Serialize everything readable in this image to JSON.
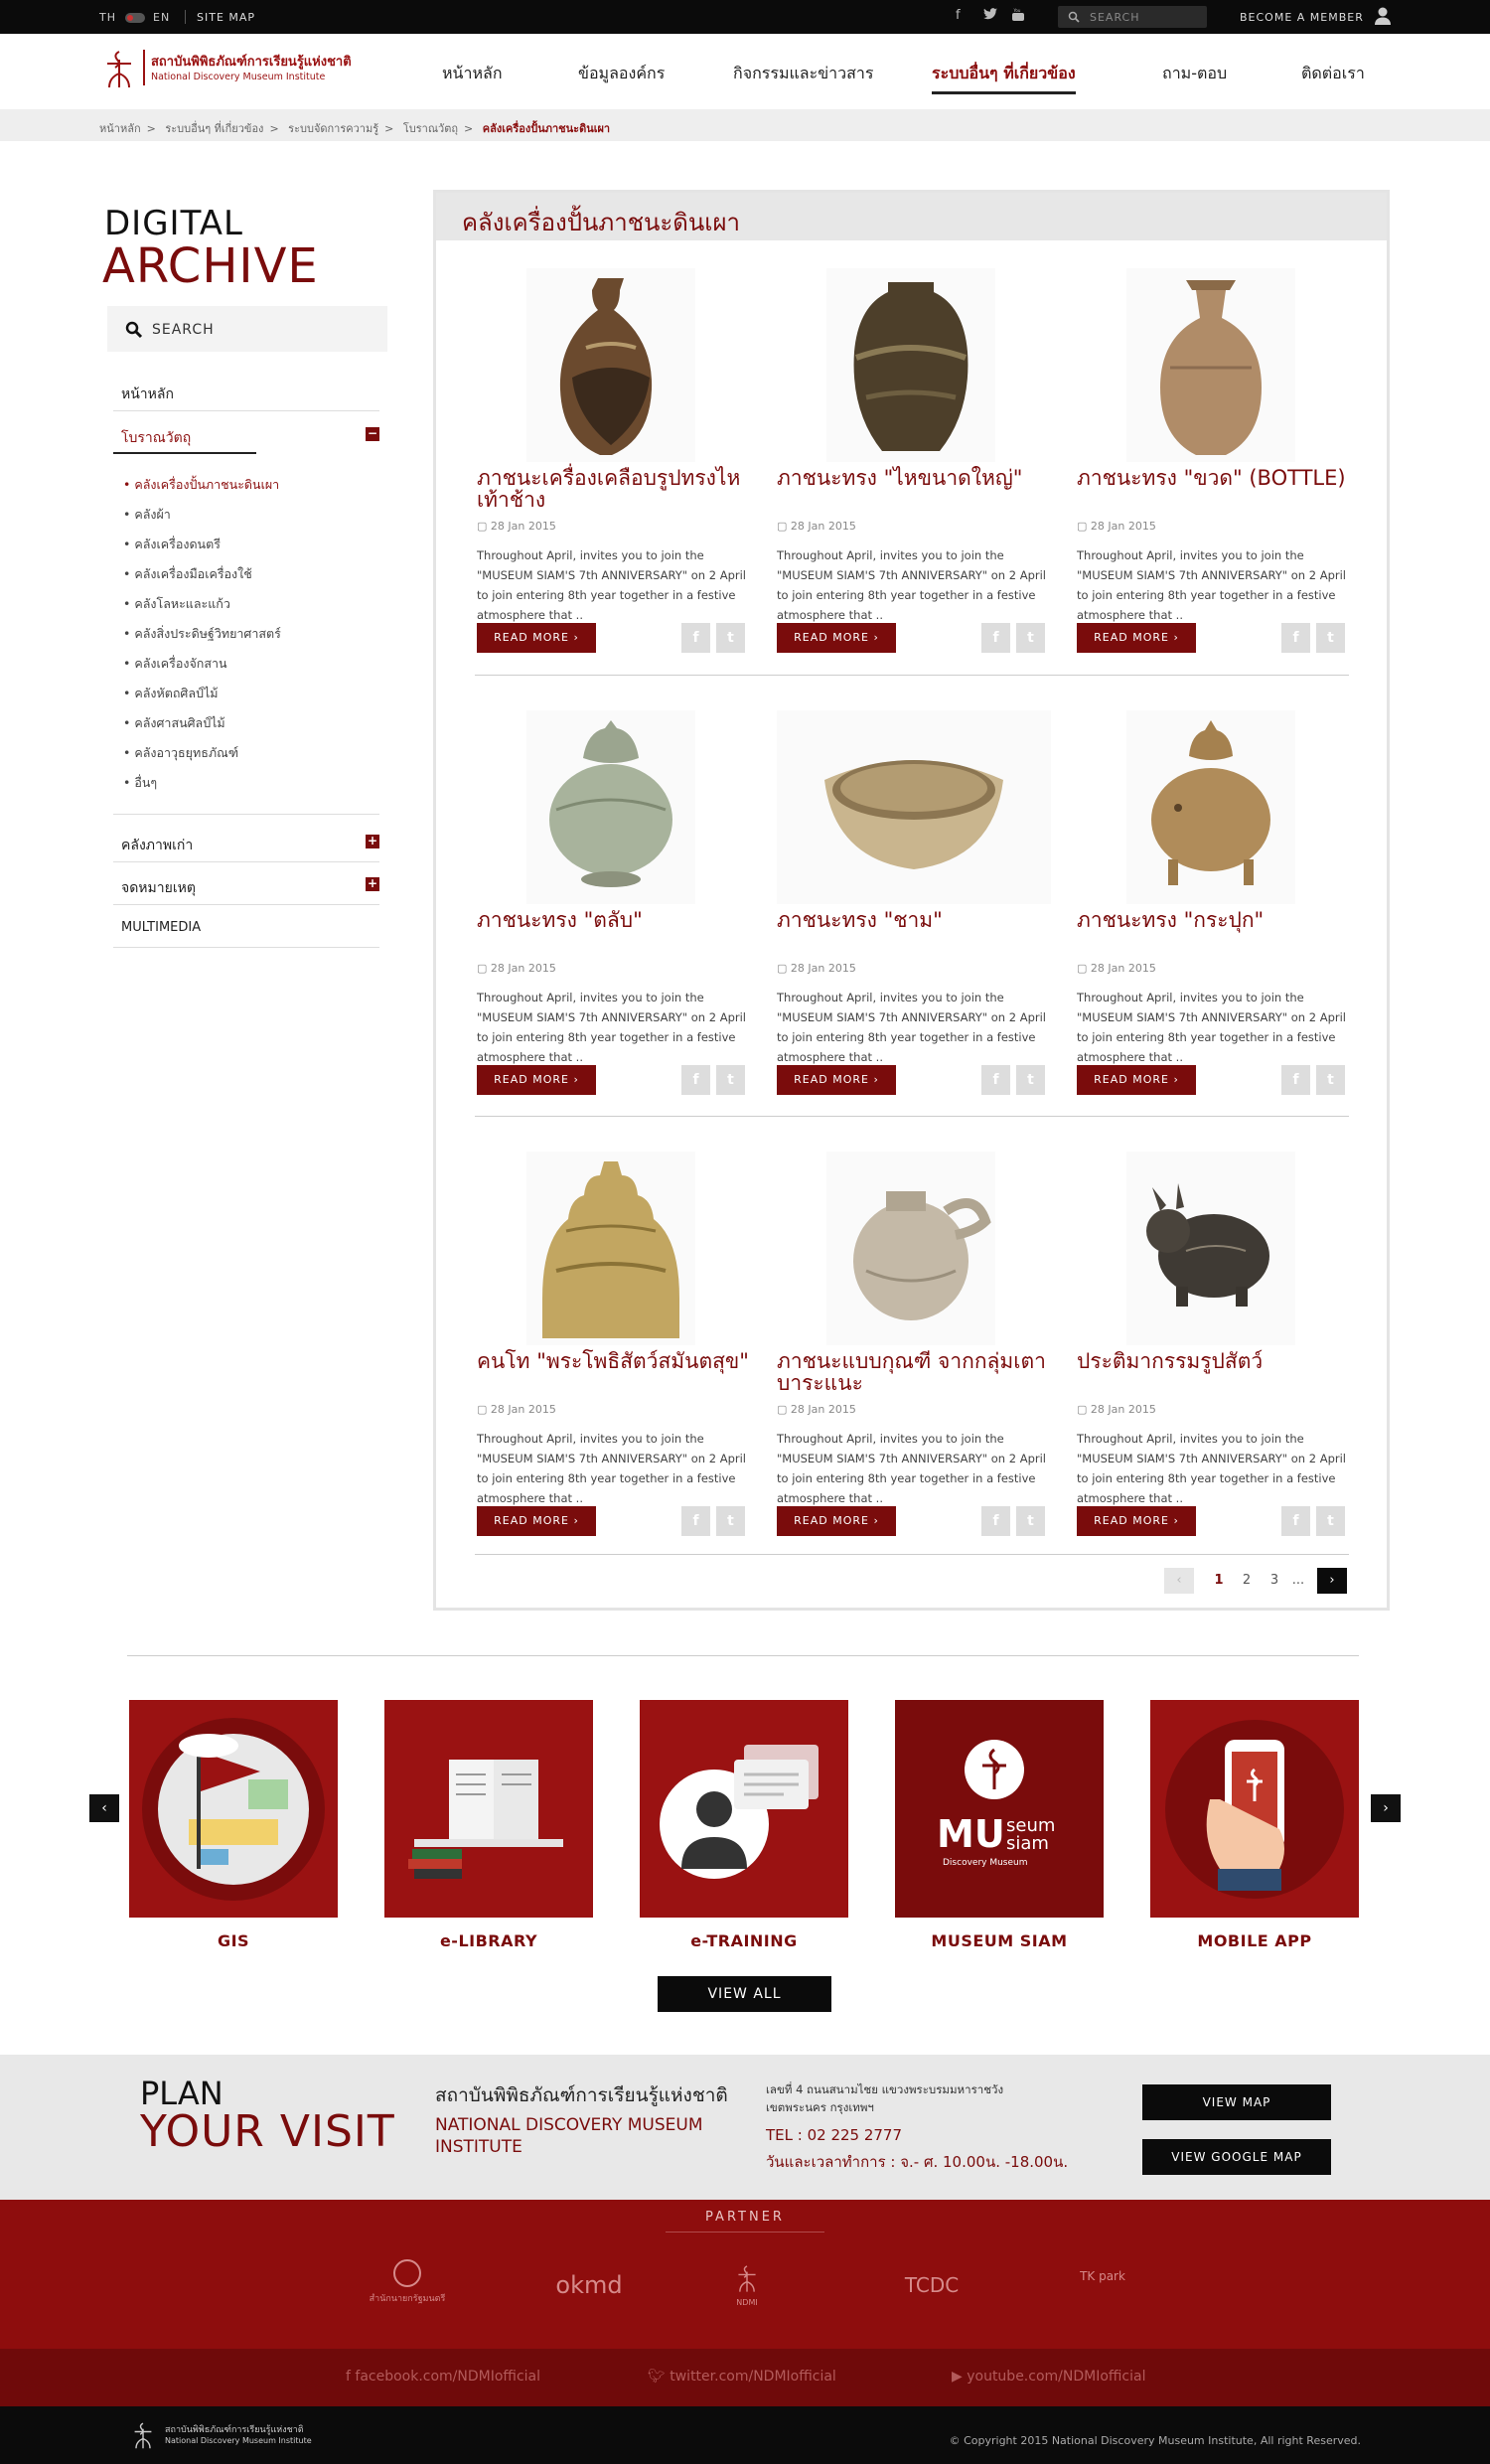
{
  "topbar": {
    "lang_th": "TH",
    "lang_en": "EN",
    "site_map": "SITE MAP",
    "search_placeholder": "SEARCH",
    "become_member": "BECOME A MEMBER"
  },
  "logo": {
    "th": "สถาบันพิพิธภัณฑ์การเรียนรู้แห่งชาติ",
    "en": "National Discovery Museum Institute"
  },
  "nav": {
    "items": [
      "หน้าหลัก",
      "ข้อมูลองค์กร",
      "กิจกรรมและข่าวสาร",
      "ระบบอื่นๆ ที่เกี่ยวข้อง",
      "ถาม-ตอบ",
      "ติดต่อเรา"
    ],
    "active_index": 3
  },
  "breadcrumb": [
    "หน้าหลัก",
    "ระบบอื่นๆ ที่เกี่ยวข้อง",
    "ระบบจัดการความรู้",
    "โบราณวัตถุ",
    "คลังเครื่องปั้นภาชนะดินเผา"
  ],
  "sidebar": {
    "title1": "DIGITAL",
    "title2": "ARCHIVE",
    "search_label": "SEARCH",
    "home": "หน้าหลัก",
    "antiques": "โบราณวัตถุ",
    "sub_items": [
      "คลังเครื่องปั้นภาชนะดินเผา",
      "คลังผ้า",
      "คลังเครื่องดนตรี",
      "คลังเครื่องมือเครื่องใช้",
      "คลังโลหะและแก้ว",
      "คลังสิ่งประดิษฐ์วิทยาศาสตร์",
      "คลังเครื่องจักสาน",
      "คลังหัตถศิลป์ไม้",
      "คลังศาสนศิลป์ไม้",
      "คลังอาวุธยุทธภัณฑ์",
      "อื่นๆ"
    ],
    "old_photos": "คลังภาพเก่า",
    "archives": "จดหมายเหตุ",
    "multimedia": "MULTIMEDIA"
  },
  "main": {
    "heading": "คลังเครื่องปั้นภาชนะดินเผา",
    "read_more": "READ MORE",
    "items": [
      {
        "title": "ภาชนะเครื่องเคลือบรูปทรงไหเท้าช้าง",
        "date": "28 Jan 2015",
        "desc": "Throughout April, invites you to join the \"MUSEUM SIAM'S 7th ANNIVERSARY\" on 2 April to join entering 8th year together in a festive atmosphere that .."
      },
      {
        "title": "ภาชนะทรง \"ไหขนาดใหญ่\"",
        "date": "28 Jan 2015",
        "desc": "Throughout April, invites you to join the \"MUSEUM SIAM'S 7th ANNIVERSARY\" on 2 April to join entering 8th year together in a festive atmosphere that .."
      },
      {
        "title": "ภาชนะทรง \"ขวด\" (BOTTLE)",
        "date": "28 Jan 2015",
        "desc": "Throughout April, invites you to join the \"MUSEUM SIAM'S 7th ANNIVERSARY\" on 2 April to join entering 8th year together in a festive atmosphere that .."
      },
      {
        "title": "ภาชนะทรง \"ตลับ\"",
        "date": "28 Jan 2015",
        "desc": "Throughout April, invites you to join the \"MUSEUM SIAM'S 7th ANNIVERSARY\" on 2 April to join entering 8th year together in a festive atmosphere that .."
      },
      {
        "title": "ภาชนะทรง \"ชาม\"",
        "date": "28 Jan 2015",
        "desc": "Throughout April, invites you to join the \"MUSEUM SIAM'S 7th ANNIVERSARY\" on 2 April to join entering 8th year together in a festive atmosphere that .."
      },
      {
        "title": "ภาชนะทรง \"กระปุก\"",
        "date": "28 Jan 2015",
        "desc": "Throughout April, invites you to join the \"MUSEUM SIAM'S 7th ANNIVERSARY\" on 2 April to join entering 8th year together in a festive atmosphere that .."
      },
      {
        "title": "คนโท \"พระโพธิสัตว์สมันตสุข\"",
        "date": "28 Jan 2015",
        "desc": "Throughout April, invites you to join the \"MUSEUM SIAM'S 7th ANNIVERSARY\" on 2 April to join entering 8th year together in a festive atmosphere that .."
      },
      {
        "title": "ภาชนะแบบกุณฑี จากกลุ่มเตาบาระแนะ",
        "date": "28 Jan 2015",
        "desc": "Throughout April, invites you to join the \"MUSEUM SIAM'S 7th ANNIVERSARY\" on 2 April to join entering 8th year together in a festive atmosphere that .."
      },
      {
        "title": "ประติมากรรมรูปสัตว์",
        "date": "28 Jan 2015",
        "desc": "Throughout April, invites you to join the \"MUSEUM SIAM'S 7th ANNIVERSARY\" on 2 April to join entering 8th year together in a festive atmosphere that .."
      }
    ],
    "pagination": {
      "pages": [
        "1",
        "2",
        "3",
        "..."
      ],
      "current": "1"
    }
  },
  "services": {
    "items": [
      "GIS",
      "e-LIBRARY",
      "e-TRAINING",
      "MUSEUM SIAM",
      "MOBILE APP"
    ],
    "view_all": "VIEW ALL"
  },
  "plan": {
    "line1": "PLAN",
    "line2": "YOUR VISIT",
    "name_th": "สถาบันพิพิธภัณฑ์การเรียนรู้แห่งชาติ",
    "name_en": "NATIONAL DISCOVERY MUSEUM INSTITUTE",
    "address": "เลขที่ 4 ถนนสนามไชย แขวงพระบรมมหาราชวัง เขตพระนคร กรุงเทพฯ",
    "tel": "TEL : 02 225 2777",
    "hours": "วันและเวลาทำการ : จ.- ศ. 10.00น. -18.00น.",
    "view_map": "VIEW MAP",
    "view_google_map": "VIEW GOOGLE MAP"
  },
  "partner": {
    "title": "PARTNER",
    "logos": [
      "สำนักนายกรัฐมนตรี",
      "okmd",
      "NDMI",
      "TCDC",
      "TK park"
    ]
  },
  "social": {
    "facebook": "facebook.com/NDMIofficial",
    "twitter": "twitter.com/NDMIofficial",
    "youtube": "youtube.com/NDMIofficial"
  },
  "footer": {
    "copyright": "© Copyright 2015 National Discovery Museum Institute, All right Reserved.",
    "logo_th": "สถาบันพิพิธภัณฑ์การเรียนรู้แห่งชาติ",
    "logo_en": "National Discovery Museum Institute"
  },
  "colors": {
    "brand": "#7a0c0c",
    "partner_bg": "#8e0d0d",
    "dark": "#0b0b0b"
  }
}
